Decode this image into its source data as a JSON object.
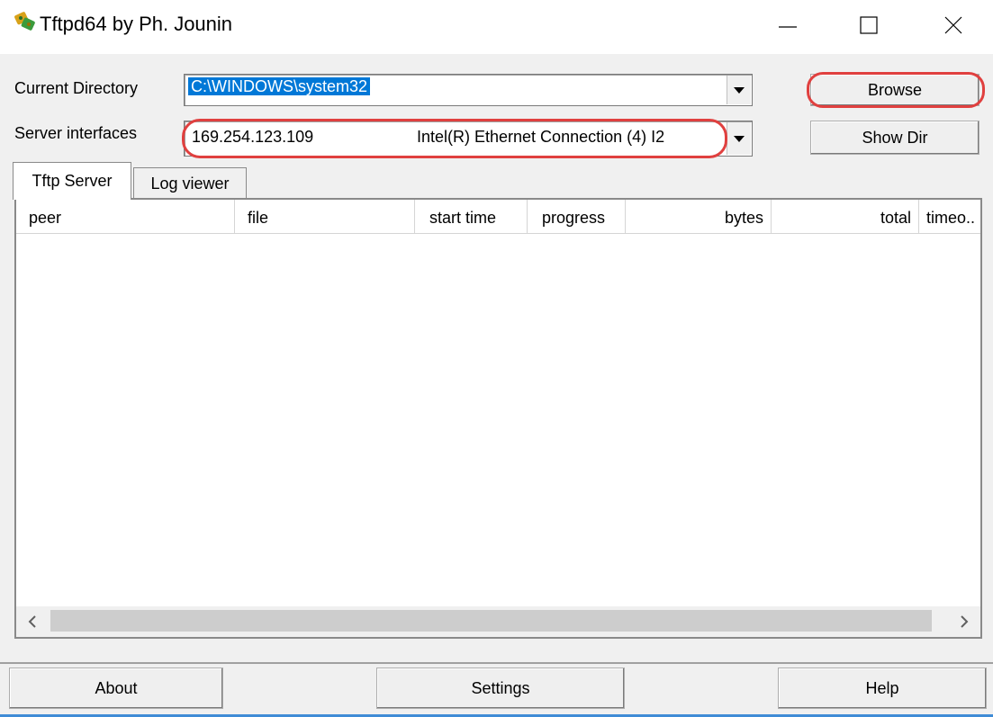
{
  "window": {
    "title": "Tftpd64 by Ph. Jounin",
    "icon": "tftpd-app-icon"
  },
  "labels": {
    "current_directory": "Current Directory",
    "server_interfaces": "Server interfaces"
  },
  "current_directory": {
    "value": "C:\\WINDOWS\\system32"
  },
  "server_interface": {
    "ip": "169.254.123.109",
    "adapter": "Intel(R) Ethernet Connection (4) I2"
  },
  "buttons": {
    "browse": "Browse",
    "show_dir": "Show Dir",
    "about": "About",
    "settings": "Settings",
    "help": "Help"
  },
  "tabs": [
    "Tftp Server",
    "Log viewer"
  ],
  "table": {
    "columns": [
      "peer",
      "file",
      "start time",
      "progress",
      "bytes",
      "total",
      "timeo.."
    ]
  },
  "colors": {
    "selection": "#0078d7",
    "highlight_annotation": "#e0403f"
  }
}
